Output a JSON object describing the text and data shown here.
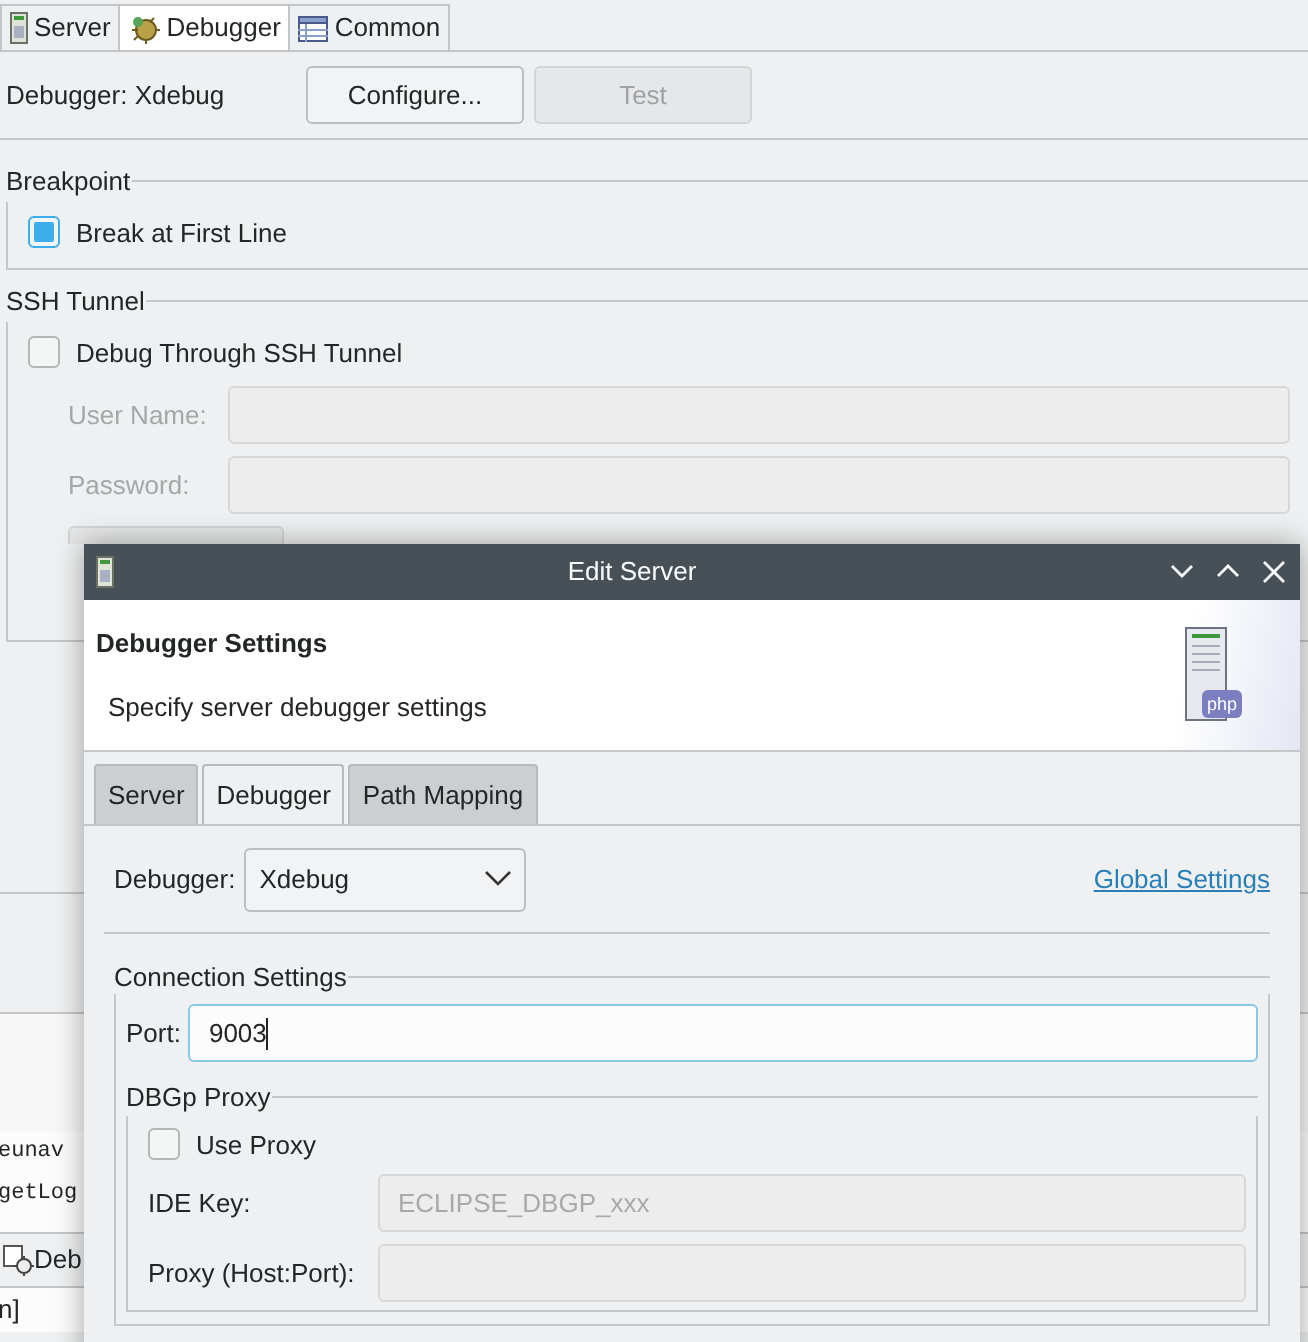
{
  "editor_tabs": [
    {
      "label": "Server",
      "selected": false,
      "kind": "server"
    },
    {
      "label": "Debugger",
      "selected": true,
      "kind": "bug"
    },
    {
      "label": "Common",
      "selected": false,
      "kind": "table"
    }
  ],
  "debugger_label": "Debugger: Xdebug",
  "configure_button": {
    "label": "Configure...",
    "disabled": false
  },
  "test_button": {
    "label": "Test",
    "disabled": true
  },
  "breakpoint_group": {
    "title": "Breakpoint",
    "checkbox": {
      "label": "Break at First Line",
      "checked": true
    }
  },
  "ssh_group": {
    "title": "SSH Tunnel",
    "checkbox": {
      "label": "Debug Through SSH Tunnel",
      "checked": false
    },
    "fields": [
      {
        "label": "User Name:",
        "disabled": true
      },
      {
        "label": "Password:",
        "disabled": true
      }
    ]
  },
  "background_fragments": [
    {
      "text": "eunav",
      "kind": "code"
    },
    {
      "text": "getLog",
      "kind": "code"
    },
    {
      "text": "Deb",
      "kind": "view-tab"
    },
    {
      "text": "n]",
      "kind": "plain"
    }
  ],
  "dialog": {
    "title": "Edit Server",
    "header": {
      "title": "Debugger Settings",
      "description": "Specify server debugger settings",
      "icon_label": "php"
    },
    "tabs": [
      {
        "label": "Server",
        "selected": false
      },
      {
        "label": "Debugger",
        "selected": true
      },
      {
        "label": "Path Mapping",
        "selected": false
      }
    ],
    "debugger": {
      "label": "Debugger:",
      "value": "Xdebug"
    },
    "link": "Global Settings",
    "connection": {
      "title": "Connection Settings",
      "port": {
        "label": "Port:",
        "value": "9003",
        "focused": true
      },
      "proxy": {
        "title": "DBGp Proxy",
        "checkbox": {
          "label": "Use Proxy",
          "checked": false
        },
        "fields": [
          {
            "label": "IDE Key:",
            "value": "ECLIPSE_DBGP_xxx",
            "disabled": true
          },
          {
            "label": "Proxy (Host:Port):",
            "disabled": true
          }
        ]
      }
    }
  }
}
